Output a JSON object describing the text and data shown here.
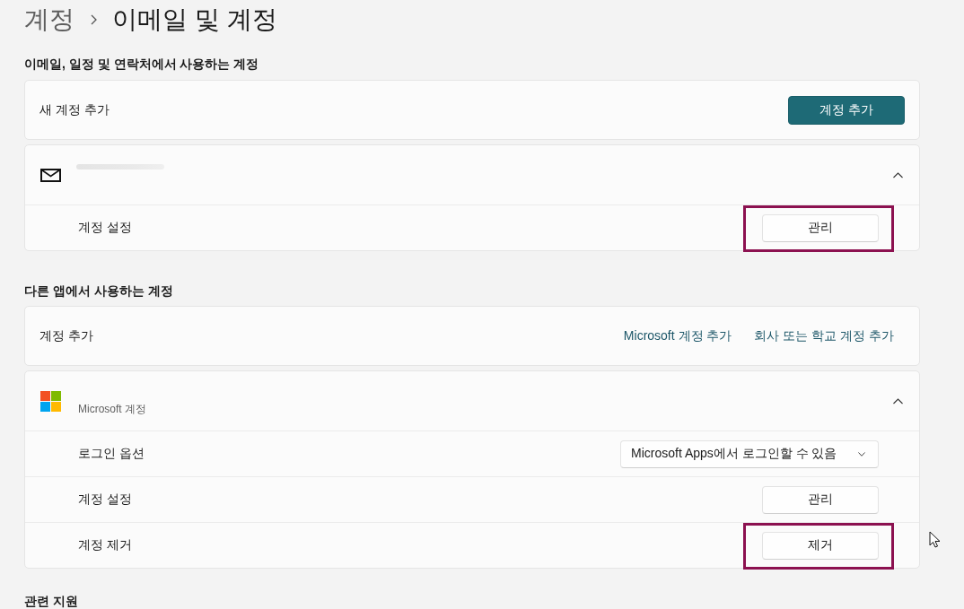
{
  "breadcrumb": [
    {
      "label": "계정",
      "current": false
    },
    {
      "label": "이메일 및 계정",
      "current": true
    }
  ],
  "sections": [
    {
      "heading": "이메일, 일정 및 연락처에서 사용하는 계정",
      "cards": [
        {
          "kind": "action",
          "label": "새 계정 추가",
          "button": {
            "label": "계정 추가",
            "kind": "accent"
          }
        },
        {
          "kind": "email_account",
          "redacted_title": true,
          "expanded": true,
          "rows": [
            {
              "kind": "button",
              "label": "계정 설정",
              "button": {
                "label": "관리",
                "kind": "standard",
                "highlighted": true
              }
            }
          ]
        }
      ]
    },
    {
      "heading": "다른 앱에서 사용하는 계정",
      "cards": [
        {
          "kind": "links",
          "label": "계정 추가",
          "links": [
            "Microsoft 계정 추가",
            "회사 또는 학교 계정 추가"
          ]
        },
        {
          "kind": "microsoft_account",
          "subtitle": "Microsoft 계정",
          "expanded": true,
          "rows": [
            {
              "kind": "dropdown",
              "label": "로그인 옵션",
              "value": "Microsoft Apps에서 로그인할 수 있음"
            },
            {
              "kind": "button",
              "label": "계정 설정",
              "button": {
                "label": "관리",
                "kind": "standard"
              }
            },
            {
              "kind": "button",
              "label": "계정 제거",
              "button": {
                "label": "제거",
                "kind": "standard",
                "highlighted": true
              }
            }
          ]
        }
      ]
    },
    {
      "heading": "관련 지원"
    }
  ]
}
